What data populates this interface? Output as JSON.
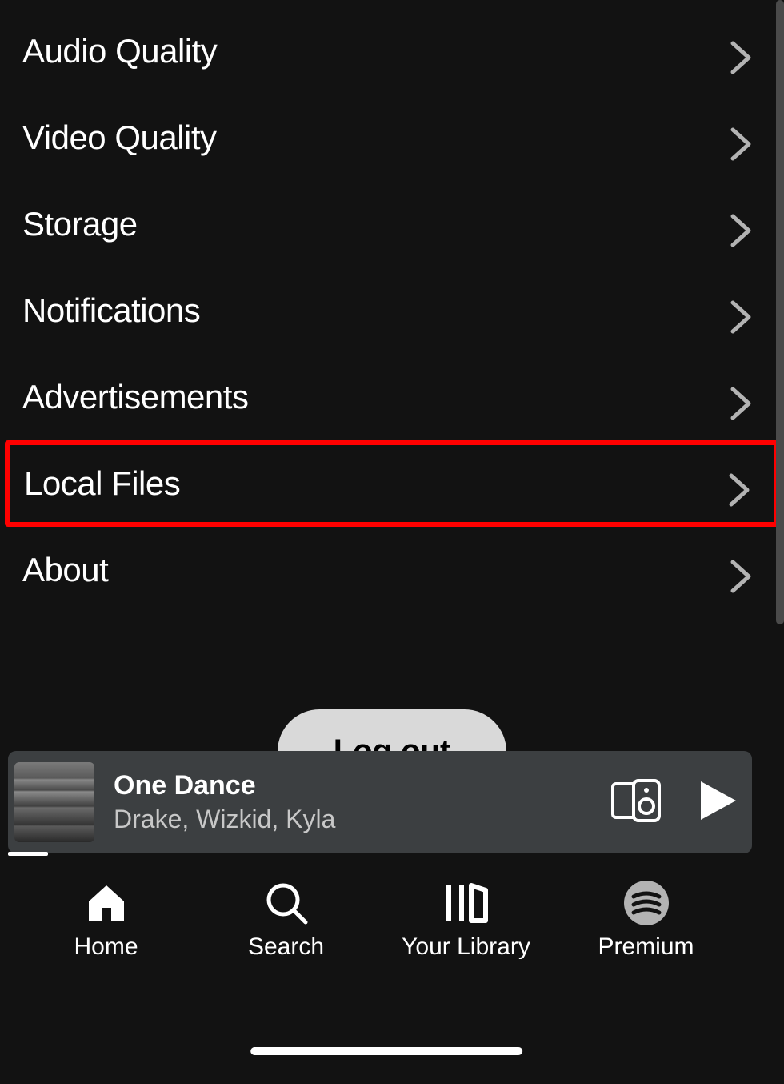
{
  "settings": {
    "items": [
      {
        "label": "Audio Quality",
        "highlighted": false,
        "name": "settings-item-audio-quality"
      },
      {
        "label": "Video Quality",
        "highlighted": false,
        "name": "settings-item-video-quality"
      },
      {
        "label": "Storage",
        "highlighted": false,
        "name": "settings-item-storage"
      },
      {
        "label": "Notifications",
        "highlighted": false,
        "name": "settings-item-notifications"
      },
      {
        "label": "Advertisements",
        "highlighted": false,
        "name": "settings-item-advertisements"
      },
      {
        "label": "Local Files",
        "highlighted": true,
        "name": "settings-item-local-files"
      },
      {
        "label": "About",
        "highlighted": false,
        "name": "settings-item-about"
      }
    ],
    "logout_label": "Log out"
  },
  "now_playing": {
    "title": "One Dance",
    "artist": "Drake, Wizkid, Kyla"
  },
  "nav": {
    "items": [
      {
        "label": "Home",
        "name": "nav-home"
      },
      {
        "label": "Search",
        "name": "nav-search"
      },
      {
        "label": "Your Library",
        "name": "nav-your-library"
      },
      {
        "label": "Premium",
        "name": "nav-premium"
      }
    ]
  }
}
